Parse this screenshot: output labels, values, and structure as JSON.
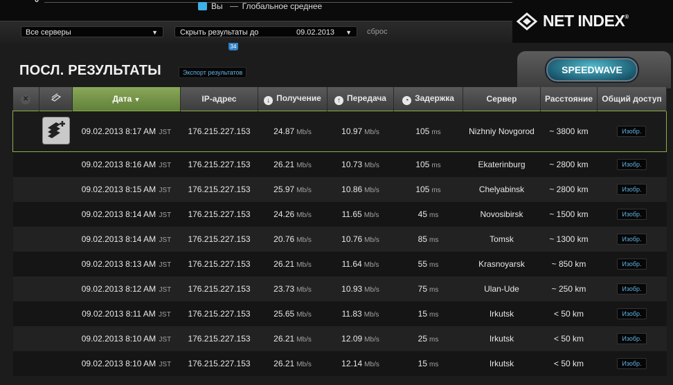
{
  "chart": {
    "axis_zero": "0",
    "legend_you": "Вы",
    "legend_global": "Глобальное среднее",
    "legend_color": "#3fb0e6"
  },
  "filters": {
    "server_select": "Все серверы",
    "hide_label": "Скрыть результаты до",
    "hide_date": "09.02.2013",
    "reset": "сброс"
  },
  "logo": {
    "text": "NET INDEX",
    "reg": "®"
  },
  "small_tab_label": "34",
  "results": {
    "title": "ПОСЛ. РЕЗУЛЬТАТЫ",
    "export": "Экспорт результатов",
    "speedwave": "SPEEDWAVE"
  },
  "columns": {
    "date": "Дата",
    "sort_indicator": "▼",
    "ip": "IP-адрес",
    "download": "Получение",
    "upload": "Передача",
    "latency": "Задержка",
    "server": "Сервер",
    "distance": "Расстояние",
    "share": "Общий доступ"
  },
  "rows": [
    {
      "date": "09.02.2013 8:17 AM",
      "tz": "JST",
      "ip": "176.215.227.153",
      "down": "24.87",
      "up": "10.97",
      "ping": "105",
      "server": "Nizhniy Novgorod",
      "distance": "~ 3800 km",
      "share": "Изобр."
    },
    {
      "date": "09.02.2013 8:16 AM",
      "tz": "JST",
      "ip": "176.215.227.153",
      "down": "26.21",
      "up": "10.73",
      "ping": "105",
      "server": "Ekaterinburg",
      "distance": "~ 2800 km",
      "share": "Изобр."
    },
    {
      "date": "09.02.2013 8:15 AM",
      "tz": "JST",
      "ip": "176.215.227.153",
      "down": "25.97",
      "up": "10.86",
      "ping": "105",
      "server": "Chelyabinsk",
      "distance": "~ 2800 km",
      "share": "Изобр."
    },
    {
      "date": "09.02.2013 8:14 AM",
      "tz": "JST",
      "ip": "176.215.227.153",
      "down": "24.26",
      "up": "11.65",
      "ping": "45",
      "server": "Novosibirsk",
      "distance": "~ 1500 km",
      "share": "Изобр."
    },
    {
      "date": "09.02.2013 8:14 AM",
      "tz": "JST",
      "ip": "176.215.227.153",
      "down": "20.76",
      "up": "10.76",
      "ping": "85",
      "server": "Tomsk",
      "distance": "~ 1300 km",
      "share": "Изобр."
    },
    {
      "date": "09.02.2013 8:13 AM",
      "tz": "JST",
      "ip": "176.215.227.153",
      "down": "26.21",
      "up": "11.64",
      "ping": "55",
      "server": "Krasnoyarsk",
      "distance": "~ 850 km",
      "share": "Изобр."
    },
    {
      "date": "09.02.2013 8:12 AM",
      "tz": "JST",
      "ip": "176.215.227.153",
      "down": "23.73",
      "up": "10.93",
      "ping": "75",
      "server": "Ulan-Ude",
      "distance": "~ 250 km",
      "share": "Изобр."
    },
    {
      "date": "09.02.2013 8:11 AM",
      "tz": "JST",
      "ip": "176.215.227.153",
      "down": "25.65",
      "up": "11.83",
      "ping": "15",
      "server": "Irkutsk",
      "distance": "< 50 km",
      "share": "Изобр."
    },
    {
      "date": "09.02.2013 8:10 AM",
      "tz": "JST",
      "ip": "176.215.227.153",
      "down": "26.21",
      "up": "12.09",
      "ping": "25",
      "server": "Irkutsk",
      "distance": "< 50 km",
      "share": "Изобр."
    },
    {
      "date": "09.02.2013 8:10 AM",
      "tz": "JST",
      "ip": "176.215.227.153",
      "down": "26.21",
      "up": "12.14",
      "ping": "15",
      "server": "Irkutsk",
      "distance": "< 50 km",
      "share": "Изобр."
    }
  ],
  "units": {
    "speed": "Mb/s",
    "latency": "ms"
  }
}
